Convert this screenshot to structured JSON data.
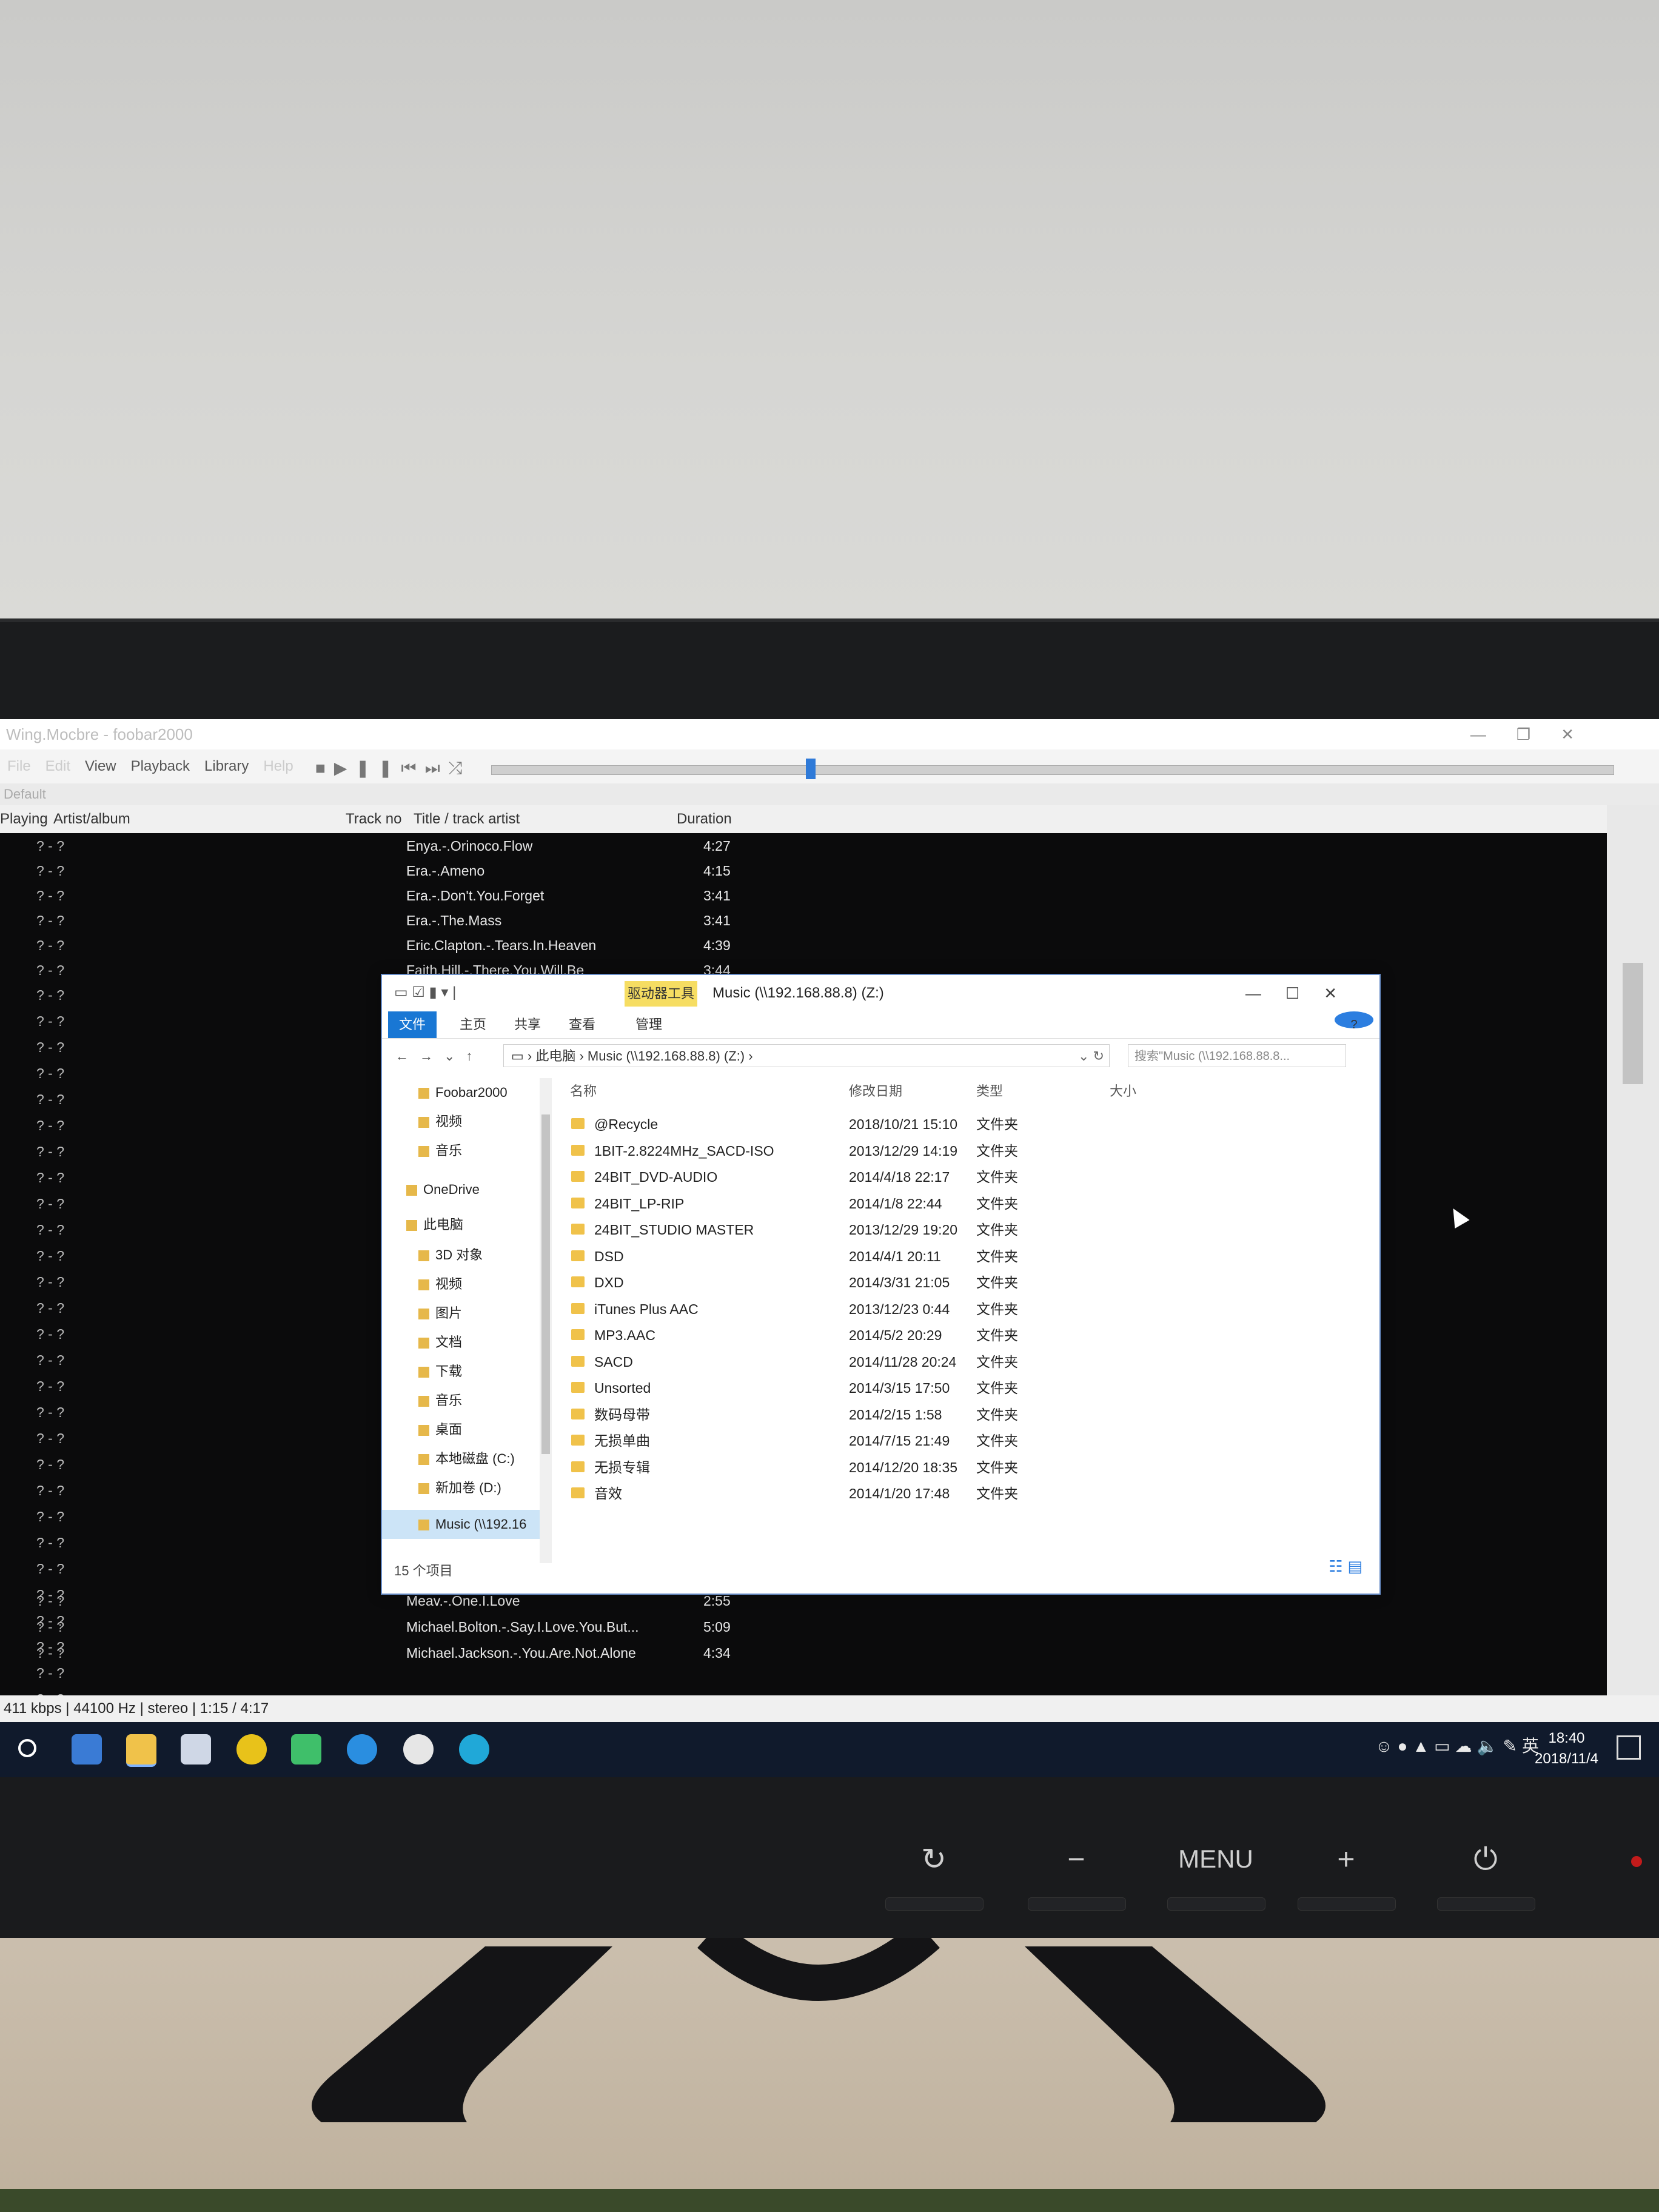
{
  "foobar": {
    "window_title": "Wing.Mocbre - foobar2000",
    "menu": [
      "File",
      "Edit",
      "View",
      "Playback",
      "Library",
      "Help"
    ],
    "playlist_tab": "Default",
    "columns": {
      "playing": "Playing",
      "artist_album": "Artist/album",
      "track_no": "Track no",
      "title": "Title / track artist",
      "duration": "Duration"
    },
    "seek_progress": 0.28,
    "rows": [
      {
        "playing": "? - ?",
        "title": "Enya.-.Orinoco.Flow",
        "duration": "4:27"
      },
      {
        "playing": "? - ?",
        "title": "Era.-.Ameno",
        "duration": "4:15"
      },
      {
        "playing": "? - ?",
        "title": "Era.-.Don't.You.Forget",
        "duration": "3:41"
      },
      {
        "playing": "? - ?",
        "title": "Era.-.The.Mass",
        "duration": "3:41"
      },
      {
        "playing": "? - ?",
        "title": "Eric.Clapton.-.Tears.In.Heaven",
        "duration": "4:39"
      },
      {
        "playing": "? - ?",
        "title": "Faith.Hill.-.There.You.Will.Be",
        "duration": "3:44"
      }
    ],
    "bottom_rows": [
      {
        "playing": "? - ?",
        "title": "Meav.-.One.I.Love",
        "duration": "2:55"
      },
      {
        "playing": "? - ?",
        "title": "Michael.Bolton.-.Say.I.Love.You.But...",
        "duration": "5:09"
      },
      {
        "playing": "? - ?",
        "title": "Michael.Jackson.-.You.Are.Not.Alone",
        "duration": "4:34"
      }
    ],
    "status": "411 kbps | 44100 Hz | stereo | 1:15 / 4:17"
  },
  "explorer": {
    "context_tab": "驱动器工具",
    "title": "Music (\\\\192.168.88.8) (Z:)",
    "ribbon": [
      "文件",
      "主页",
      "共享",
      "查看",
      "管理"
    ],
    "breadcrumb": [
      "此电脑",
      "Music (\\\\192.168.88.8) (Z:)"
    ],
    "search_placeholder": "搜索\"Music (\\\\192.168.88.8...",
    "columns": {
      "name": "名称",
      "date": "修改日期",
      "type": "类型",
      "size": "大小"
    },
    "nav_items": [
      {
        "label": "Foobar2000"
      },
      {
        "label": "视频"
      },
      {
        "label": "音乐"
      },
      {
        "label": "OneDrive"
      },
      {
        "label": "此电脑"
      },
      {
        "label": "3D 对象"
      },
      {
        "label": "视频"
      },
      {
        "label": "图片"
      },
      {
        "label": "文档"
      },
      {
        "label": "下载"
      },
      {
        "label": "音乐"
      },
      {
        "label": "桌面"
      },
      {
        "label": "本地磁盘 (C:)"
      },
      {
        "label": "新加卷 (D:)"
      },
      {
        "label": "Music (\\\\192.16"
      }
    ],
    "files": [
      {
        "name": "@Recycle",
        "date": "2018/10/21 15:10",
        "type": "文件夹"
      },
      {
        "name": "1BIT-2.8224MHz_SACD-ISO",
        "date": "2013/12/29 14:19",
        "type": "文件夹"
      },
      {
        "name": "24BIT_DVD-AUDIO",
        "date": "2014/4/18 22:17",
        "type": "文件夹"
      },
      {
        "name": "24BIT_LP-RIP",
        "date": "2014/1/8 22:44",
        "type": "文件夹"
      },
      {
        "name": "24BIT_STUDIO MASTER",
        "date": "2013/12/29 19:20",
        "type": "文件夹"
      },
      {
        "name": "DSD",
        "date": "2014/4/1 20:11",
        "type": "文件夹"
      },
      {
        "name": "DXD",
        "date": "2014/3/31 21:05",
        "type": "文件夹"
      },
      {
        "name": "iTunes Plus AAC",
        "date": "2013/12/23 0:44",
        "type": "文件夹"
      },
      {
        "name": "MP3.AAC",
        "date": "2014/5/2 20:29",
        "type": "文件夹"
      },
      {
        "name": "SACD",
        "date": "2014/11/28 20:24",
        "type": "文件夹"
      },
      {
        "name": "Unsorted",
        "date": "2014/3/15 17:50",
        "type": "文件夹"
      },
      {
        "name": "数码母带",
        "date": "2014/2/15 1:58",
        "type": "文件夹"
      },
      {
        "name": "无损单曲",
        "date": "2014/7/15 21:49",
        "type": "文件夹"
      },
      {
        "name": "无损专辑",
        "date": "2014/12/20 18:35",
        "type": "文件夹"
      },
      {
        "name": "音效",
        "date": "2014/1/20 17:48",
        "type": "文件夹"
      }
    ],
    "item_count": "15 个项目"
  },
  "taskbar": {
    "time": "18:40",
    "date": "2018/11/4",
    "ime": "英"
  },
  "monitor": {
    "menu_label": "MENU",
    "minus": "−",
    "plus": "+"
  },
  "colors": {
    "taskbar": "#101a2c",
    "accent": "#1977d4",
    "context_tab": "#f6dd62",
    "seek_thumb": "#2f7ad8"
  }
}
